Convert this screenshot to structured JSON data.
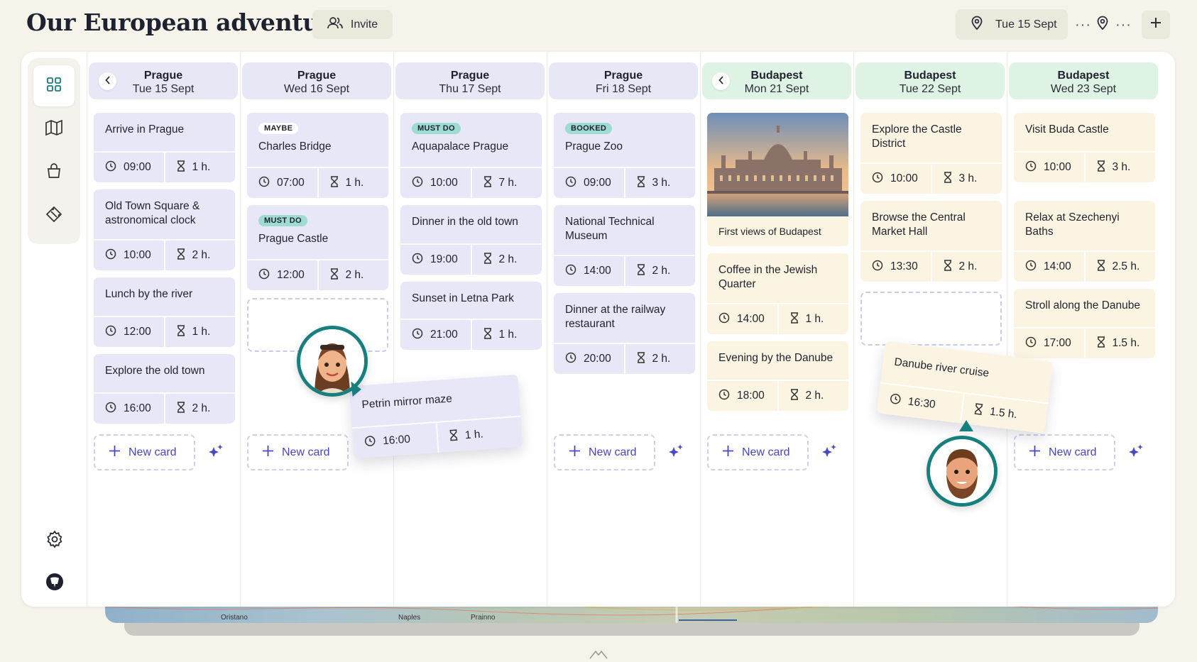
{
  "header": {
    "title": "Our European adventure",
    "invite_label": "Invite",
    "date_label": "Tue 15 Sept",
    "more_label": "···"
  },
  "map": {
    "labels": [
      "Oristano",
      "Naples",
      "Prainno"
    ]
  },
  "columns": [
    {
      "city": "Prague",
      "date": "Tue 15 Sept"
    },
    {
      "city": "Prague",
      "date": "Wed 16 Sept"
    },
    {
      "city": "Prague",
      "date": "Thu 17 Sept"
    },
    {
      "city": "Prague",
      "date": "Fri 18 Sept"
    },
    {
      "city": "Budapest",
      "date": "Mon 21 Sept"
    },
    {
      "city": "Budapest",
      "date": "Tue 22 Sept"
    },
    {
      "city": "Budapest",
      "date": "Wed 23 Sept"
    }
  ],
  "cards": {
    "c0": [
      {
        "title": "Arrive in Prague",
        "time": "09:00",
        "duration": "1 h."
      },
      {
        "title": "Old Town Square & astronomical clock",
        "time": "10:00",
        "duration": "2 h."
      },
      {
        "title": "Lunch by the river",
        "time": "12:00",
        "duration": "1 h."
      },
      {
        "title": "Explore the old town",
        "time": "16:00",
        "duration": "2 h."
      }
    ],
    "c1": [
      {
        "badge": "MAYBE",
        "title": "Charles Bridge",
        "time": "07:00",
        "duration": "1 h."
      },
      {
        "badge": "MUST DO",
        "title": "Prague Castle",
        "time": "12:00",
        "duration": "2 h."
      }
    ],
    "c2": [
      {
        "badge": "MUST DO",
        "title": "Aquapalace Prague",
        "time": "10:00",
        "duration": "7 h."
      },
      {
        "title": "Dinner in the old town",
        "time": "19:00",
        "duration": "2 h."
      },
      {
        "title": "Sunset in Letna Park",
        "time": "21:00",
        "duration": "1 h."
      }
    ],
    "c3": [
      {
        "badge": "BOOKED",
        "title": "Prague Zoo",
        "time": "09:00",
        "duration": "3 h."
      },
      {
        "title": "National Technical Museum",
        "time": "14:00",
        "duration": "2 h."
      },
      {
        "title": "Dinner at the railway restaurant",
        "time": "20:00",
        "duration": "2 h."
      }
    ],
    "c4": [
      {
        "caption": "First views of Budapest"
      },
      {
        "title": "Coffee in the Jewish Quarter",
        "time": "14:00",
        "duration": "1 h."
      },
      {
        "title": "Evening by the Danube",
        "time": "18:00",
        "duration": "2 h."
      }
    ],
    "c5": [
      {
        "title": "Explore the Castle District",
        "time": "10:00",
        "duration": "3 h."
      },
      {
        "title": "Browse the Central Market Hall",
        "time": "13:30",
        "duration": "2 h."
      }
    ],
    "c6": [
      {
        "title": "Visit Buda Castle",
        "time": "10:00",
        "duration": "3 h."
      },
      {
        "title": "Relax at Szechenyi Baths",
        "time": "14:00",
        "duration": "2.5 h."
      },
      {
        "title": "Stroll along the Danube",
        "time": "17:00",
        "duration": "1.5 h."
      }
    ]
  },
  "dragging": [
    {
      "title": "Petrin mirror maze",
      "time": "16:00",
      "duration": "1 h."
    },
    {
      "title": "Danube river cruise",
      "time": "16:30",
      "duration": "1.5 h."
    }
  ],
  "new_card_label": "New card",
  "colors": {
    "accent": "#4a45c4",
    "prague_header": "#e7e7f5",
    "budapest_header": "#dff3e4",
    "avatar_ring": "#177f7d"
  }
}
